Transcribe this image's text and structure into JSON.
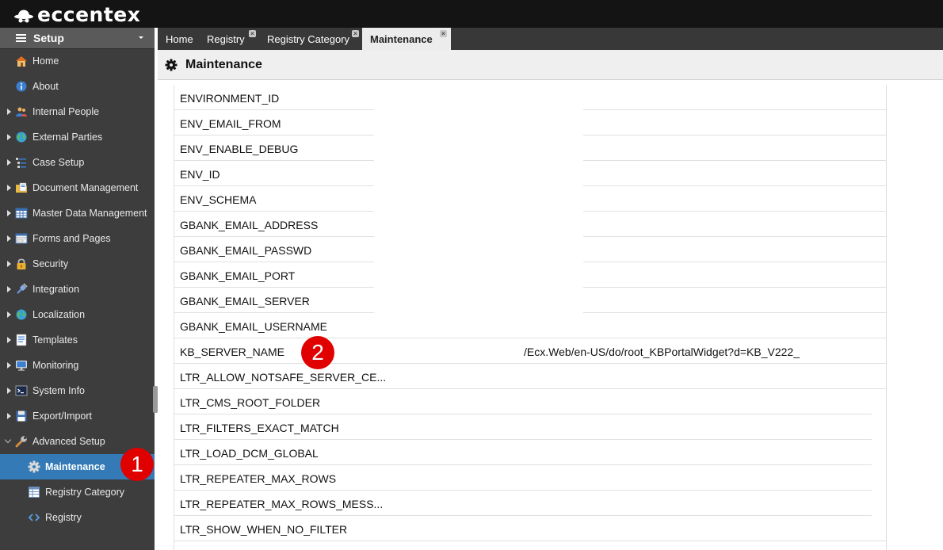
{
  "app": {
    "brand": "eccentex"
  },
  "sidebar": {
    "header": "Setup",
    "items": [
      {
        "label": "Home",
        "icon": "house-icon",
        "expandable": false
      },
      {
        "label": "About",
        "icon": "info-icon",
        "expandable": false
      },
      {
        "label": "Internal People",
        "icon": "people-icon",
        "expandable": true
      },
      {
        "label": "External Parties",
        "icon": "globe-icon",
        "expandable": true
      },
      {
        "label": "Case Setup",
        "icon": "list-tree-icon",
        "expandable": true
      },
      {
        "label": "Document Management",
        "icon": "folder-document-icon",
        "expandable": true
      },
      {
        "label": "Master Data Management",
        "icon": "grid-icon",
        "expandable": true
      },
      {
        "label": "Forms and Pages",
        "icon": "form-icon",
        "expandable": true
      },
      {
        "label": "Security",
        "icon": "lock-icon",
        "expandable": true
      },
      {
        "label": "Integration",
        "icon": "plug-icon",
        "expandable": true
      },
      {
        "label": "Localization",
        "icon": "globe-icon",
        "expandable": true
      },
      {
        "label": "Templates",
        "icon": "template-icon",
        "expandable": true
      },
      {
        "label": "Monitoring",
        "icon": "monitor-icon",
        "expandable": true
      },
      {
        "label": "System Info",
        "icon": "terminal-icon",
        "expandable": true
      },
      {
        "label": "Export/Import",
        "icon": "floppy-icon",
        "expandable": true
      },
      {
        "label": "Advanced Setup",
        "icon": "wrench-icon",
        "expanded": true
      },
      {
        "label": "Maintenance",
        "icon": "gear-icon",
        "sub": true,
        "active": true
      },
      {
        "label": "Registry Category",
        "icon": "table-icon",
        "sub": true
      },
      {
        "label": "Registry",
        "icon": "code-icon",
        "sub": true
      }
    ]
  },
  "tabs": [
    {
      "label": "Home",
      "closable": false
    },
    {
      "label": "Registry",
      "closable": true
    },
    {
      "label": "Registry Category",
      "closable": true
    },
    {
      "label": "Maintenance",
      "closable": true,
      "active": true
    }
  ],
  "page": {
    "title": "Maintenance"
  },
  "rows": [
    {
      "key": "ENVIRONMENT_ID",
      "value": ""
    },
    {
      "key": "ENV_EMAIL_FROM",
      "value": ""
    },
    {
      "key": "ENV_ENABLE_DEBUG",
      "value": ""
    },
    {
      "key": "ENV_ID",
      "value": ""
    },
    {
      "key": "ENV_SCHEMA",
      "value": ""
    },
    {
      "key": "GBANK_EMAIL_ADDRESS",
      "value": ""
    },
    {
      "key": "GBANK_EMAIL_PASSWD",
      "value": ""
    },
    {
      "key": "GBANK_EMAIL_PORT",
      "value": ""
    },
    {
      "key": "GBANK_EMAIL_SERVER",
      "value": ""
    },
    {
      "key": "GBANK_EMAIL_USERNAME",
      "value": ""
    },
    {
      "key": "KB_SERVER_NAME",
      "value": "/Ecx.Web/en-US/do/root_KBPortalWidget?d=KB_V222_"
    },
    {
      "key": "LTR_ALLOW_NOTSAFE_SERVER_CE...",
      "value": ""
    },
    {
      "key": "LTR_CMS_ROOT_FOLDER",
      "value": ""
    },
    {
      "key": "LTR_FILTERS_EXACT_MATCH",
      "value": ""
    },
    {
      "key": "LTR_LOAD_DCM_GLOBAL",
      "value": ""
    },
    {
      "key": "LTR_REPEATER_MAX_ROWS",
      "value": ""
    },
    {
      "key": "LTR_REPEATER_MAX_ROWS_MESS...",
      "value": ""
    },
    {
      "key": "LTR_SHOW_WHEN_NO_FILTER",
      "value": ""
    }
  ],
  "annotations": [
    {
      "label": "1"
    },
    {
      "label": "2"
    }
  ],
  "colors": {
    "active": "#337ab7",
    "badge": "#e00000",
    "sidebar": "#3d3d3d",
    "topbar": "#141414"
  }
}
